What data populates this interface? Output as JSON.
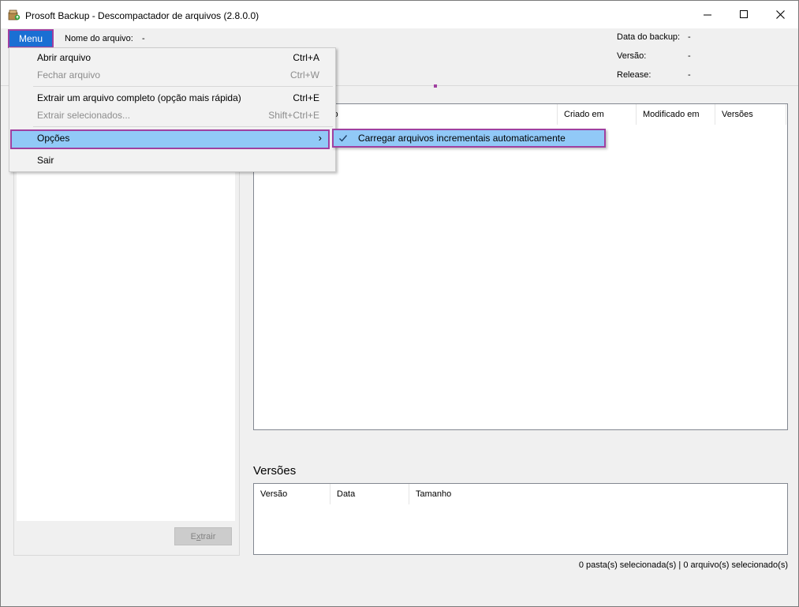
{
  "window": {
    "title": "Prosoft Backup - Descompactador de arquivos (2.8.0.0)",
    "icon": "backup-box-icon",
    "controls": [
      "minimize-icon",
      "maximize-icon",
      "close-icon"
    ]
  },
  "header": {
    "menu_label": "Menu",
    "file_name_label": "Nome do arquivo:",
    "file_name_value": "-",
    "backup_date_label": "Data do backup:",
    "backup_date_value": "-",
    "version_label": "Versão:",
    "version_value": "-",
    "release_label": "Release:",
    "release_value": "-"
  },
  "menu": {
    "items": [
      {
        "label": "Abrir arquivo",
        "shortcut": "Ctrl+A",
        "enabled": true
      },
      {
        "label": "Fechar arquivo",
        "shortcut": "Ctrl+W",
        "enabled": false
      },
      {
        "label": "Extrair um arquivo completo (opção mais rápida)",
        "shortcut": "Ctrl+E",
        "enabled": true
      },
      {
        "label": "Extrair selecionados...",
        "shortcut": "Shift+Ctrl+E",
        "enabled": false
      },
      {
        "label": "Opções",
        "shortcut": "",
        "enabled": true,
        "highlighted": true,
        "submenu_arrow": "›"
      },
      {
        "label": "Sair",
        "shortcut": "",
        "enabled": true
      }
    ],
    "submenu": {
      "items": [
        {
          "label": "Carregar arquivos incrementais automaticamente",
          "checked": true
        }
      ]
    }
  },
  "files_table": {
    "columns": [
      "vo",
      "Criado em",
      "Modificado em",
      "Versões"
    ]
  },
  "versions_section": {
    "title": "Versões",
    "columns": [
      "Versão",
      "Data",
      "Tamanho"
    ]
  },
  "left_panel": {
    "extract_button_prefix": "E",
    "extract_button_underlined": "x",
    "extract_button_suffix": "trair"
  },
  "status": {
    "text": "0 pasta(s) selecionada(s) | 0 arquivo(s) selecionado(s)"
  },
  "colors": {
    "menu_button": "#1a6fd3",
    "highlight": "#91c9f7",
    "annotation_border": "#a040a0",
    "window_bg": "#f0f0f0"
  }
}
